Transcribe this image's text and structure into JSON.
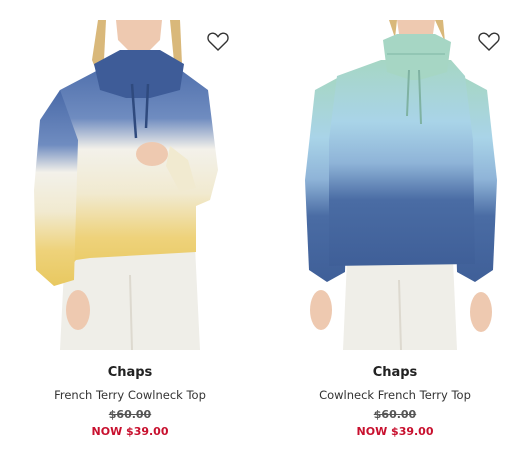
{
  "products": [
    {
      "brand": "Chaps",
      "name": "French Terry Cowlneck Top",
      "original_price": "$60.00",
      "sale_price": "NOW $39.00",
      "image_colors": [
        "#4a6aa8",
        "#f3f1ea",
        "#eed27a"
      ],
      "wishlist_icon": "heart-outline-icon"
    },
    {
      "brand": "Chaps",
      "name": "Cowlneck French Terry Top",
      "original_price": "$60.00",
      "sale_price": "NOW $39.00",
      "image_colors": [
        "#a6d6c4",
        "#a9d4e8",
        "#3f5f98"
      ],
      "wishlist_icon": "heart-outline-icon"
    }
  ],
  "colors": {
    "sale": "#c8102e",
    "strike": "#555555"
  }
}
